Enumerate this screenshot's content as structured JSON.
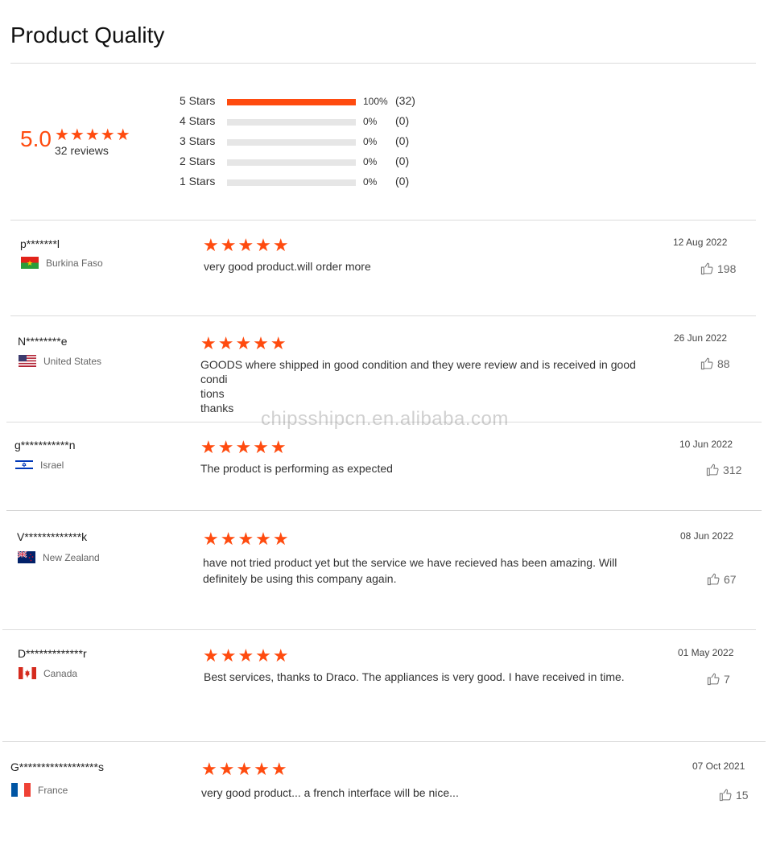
{
  "header": {
    "title": "Product Quality"
  },
  "summary": {
    "score": "5.0",
    "stars": "★★★★★",
    "review_count": "32 reviews",
    "distribution": [
      {
        "label": "5 Stars",
        "percent": 100,
        "percent_text": "100%",
        "count": "(32)"
      },
      {
        "label": "4 Stars",
        "percent": 0,
        "percent_text": "0%",
        "count": "(0)"
      },
      {
        "label": "3 Stars",
        "percent": 0,
        "percent_text": "0%",
        "count": "(0)"
      },
      {
        "label": "2 Stars",
        "percent": 0,
        "percent_text": "0%",
        "count": "(0)"
      },
      {
        "label": "1 Stars",
        "percent": 0,
        "percent_text": "0%",
        "count": "(0)"
      }
    ]
  },
  "reviews": [
    {
      "user": "p*******l",
      "country": "Burkina Faso",
      "flag": "flag-burkina-faso",
      "stars": "★★★★★",
      "text": "very good product.will order more",
      "date": "12 Aug 2022",
      "likes": "198"
    },
    {
      "user": "N********e",
      "country": "United States",
      "flag": "flag-united-states",
      "stars": "★★★★★",
      "text": "GOODS where shipped in good condition and they were review and is received in good condi\ntions\nthanks",
      "date": "26 Jun 2022",
      "likes": "88"
    },
    {
      "user": "g***********n",
      "country": "Israel",
      "flag": "flag-israel",
      "stars": "★★★★★",
      "text": "The product is performing as expected",
      "date": "10 Jun 2022",
      "likes": "312"
    },
    {
      "user": "V*************k",
      "country": "New Zealand",
      "flag": "flag-new-zealand",
      "stars": "★★★★★",
      "text": "have not tried product yet but the service we have recieved has been amazing. Will definitely be using this company again.",
      "date": "08 Jun 2022",
      "likes": "67"
    },
    {
      "user": "D*************r",
      "country": "Canada",
      "flag": "flag-canada",
      "stars": "★★★★★",
      "text": "Best services, thanks to Draco. The appliances is very good. I have received in time.",
      "date": "01 May 2022",
      "likes": "7"
    },
    {
      "user": "G******************s",
      "country": "France",
      "flag": "flag-france",
      "stars": "★★★★★",
      "text": "very good product... a french interface will be nice...",
      "date": "07 Oct 2021",
      "likes": "15"
    }
  ],
  "watermark": "chipsshipcn.en.alibaba.com",
  "colors": {
    "accent": "#ff4b0f",
    "track": "#e6e6e6"
  }
}
